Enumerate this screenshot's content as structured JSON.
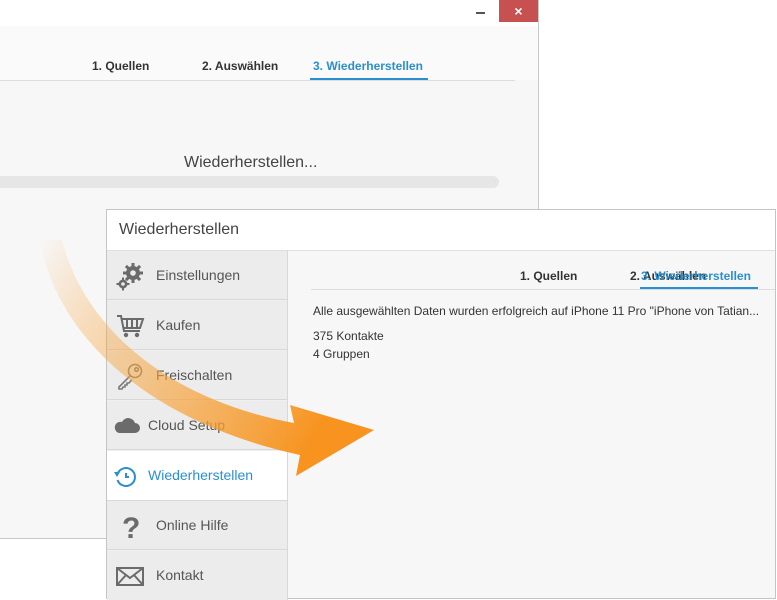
{
  "back_window": {
    "close_glyph": "×",
    "tabs": [
      {
        "label": "1. Quellen"
      },
      {
        "label": "2. Auswählen"
      },
      {
        "label": "3. Wiederherstellen"
      }
    ],
    "status_text": "Wiederherstellen..."
  },
  "front_window": {
    "title": "Wiederherstellen",
    "sidebar": {
      "items": [
        {
          "label": "Einstellungen",
          "icon": "gears-icon"
        },
        {
          "label": "Kaufen",
          "icon": "shopping-cart-icon"
        },
        {
          "label": "Freischalten",
          "icon": "key-icon"
        },
        {
          "label": "Cloud Setup",
          "icon": "cloud-icon"
        },
        {
          "label": "Wiederherstellen",
          "icon": "restore-icon"
        },
        {
          "label": "Online Hilfe",
          "icon": "question-icon"
        },
        {
          "label": "Kontakt",
          "icon": "envelope-icon"
        }
      ]
    },
    "tabs": [
      {
        "label": "1. Quellen"
      },
      {
        "label": "2. Auswählen"
      },
      {
        "label": "3. Wiederherstellen"
      }
    ],
    "result_message": "Alle ausgewählten Daten wurden erfolgreich auf iPhone 11 Pro \"iPhone von Tatian...",
    "counts": [
      "375 Kontakte",
      "4 Gruppen"
    ]
  },
  "colors": {
    "accent": "#2a8fcf",
    "close_button": "#c75050",
    "arrow": "#f7931e"
  }
}
